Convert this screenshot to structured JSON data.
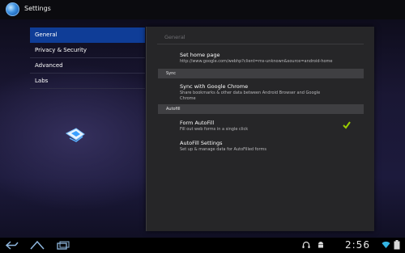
{
  "action_bar": {
    "title": "Settings",
    "icon": "settings-globe-icon"
  },
  "nav": {
    "items": [
      {
        "label": "General",
        "active": true
      },
      {
        "label": "Privacy & Security",
        "active": false
      },
      {
        "label": "Advanced",
        "active": false
      },
      {
        "label": "Labs",
        "active": false
      }
    ]
  },
  "panel": {
    "header": "General",
    "prefs": {
      "home": {
        "title": "Set home page",
        "summary": "http://www.google.com/webhp?client=ms-unknown&source=android-home"
      },
      "sync_cat": "Sync",
      "sync": {
        "title": "Sync with Google Chrome",
        "summary": "Share bookmarks & other data between Android Browser and Google Chrome"
      },
      "autofill_cat": "Autofill",
      "form_autofill": {
        "title": "Form AutoFill",
        "summary": "Fill out web forms in a single click",
        "checked": true
      },
      "autofill_settings": {
        "title": "AutoFill Settings",
        "summary": "Set up & manage data for AutoFilled forms"
      }
    }
  },
  "system_bar": {
    "clock": "2:56",
    "icons": [
      "back-icon",
      "home-icon",
      "recent-apps-icon",
      "headset-icon",
      "android-icon",
      "wifi-icon",
      "battery-icon"
    ]
  },
  "colors": {
    "accent": "#0f3d97",
    "check": "#9acd00"
  }
}
